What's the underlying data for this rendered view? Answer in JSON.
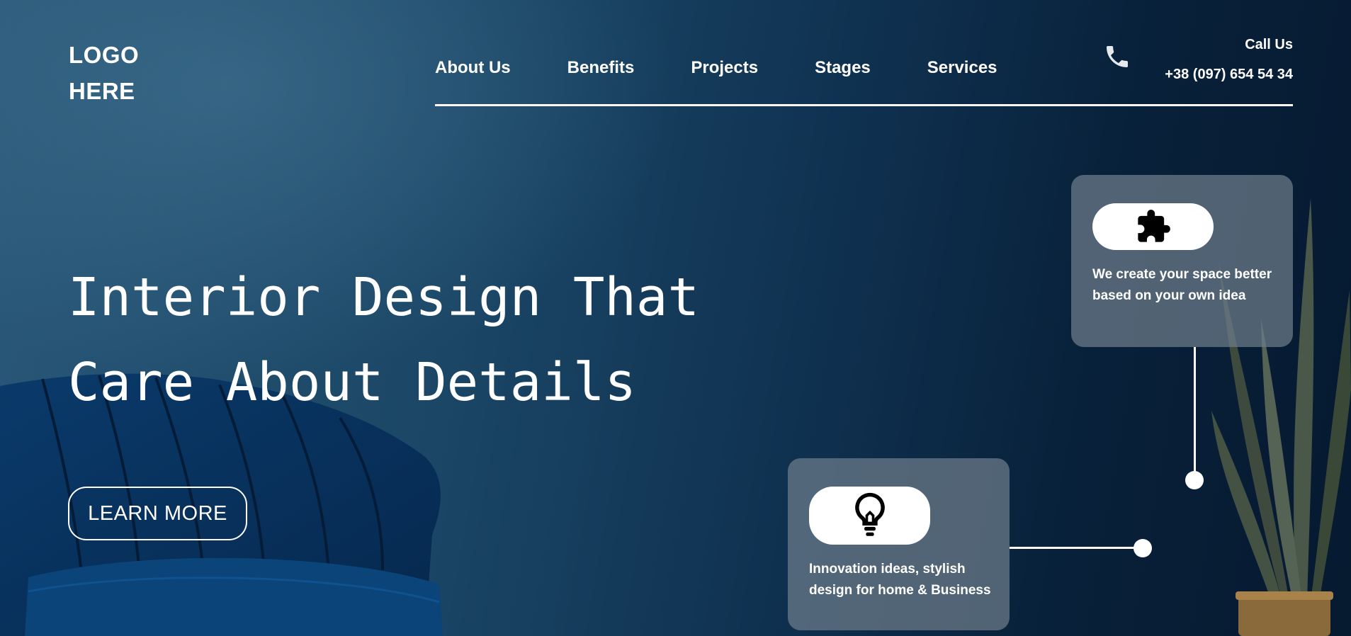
{
  "logo": {
    "line1": "LOGO",
    "line2": "HERE"
  },
  "nav": {
    "items": [
      {
        "label": "About Us"
      },
      {
        "label": "Benefits"
      },
      {
        "label": "Projects"
      },
      {
        "label": "Stages"
      },
      {
        "label": "Services"
      }
    ]
  },
  "contact": {
    "label": "Call Us",
    "phone": "+38 (097) 654 54 34",
    "icon": "phone-icon"
  },
  "hero": {
    "headline_line1": "Interior Design That",
    "headline_line2": "Care About Details",
    "cta_label": "LEARN MORE"
  },
  "cards": [
    {
      "icon": "puzzle-icon",
      "text": "We create your space better based on your own idea"
    },
    {
      "icon": "lightbulb-icon",
      "text": "Innovation ideas, stylish design for home & Business"
    }
  ],
  "colors": {
    "background_dark": "#061a30",
    "background_light": "#2a5878",
    "card_bg": "#6e7d8a",
    "text": "#ffffff"
  }
}
